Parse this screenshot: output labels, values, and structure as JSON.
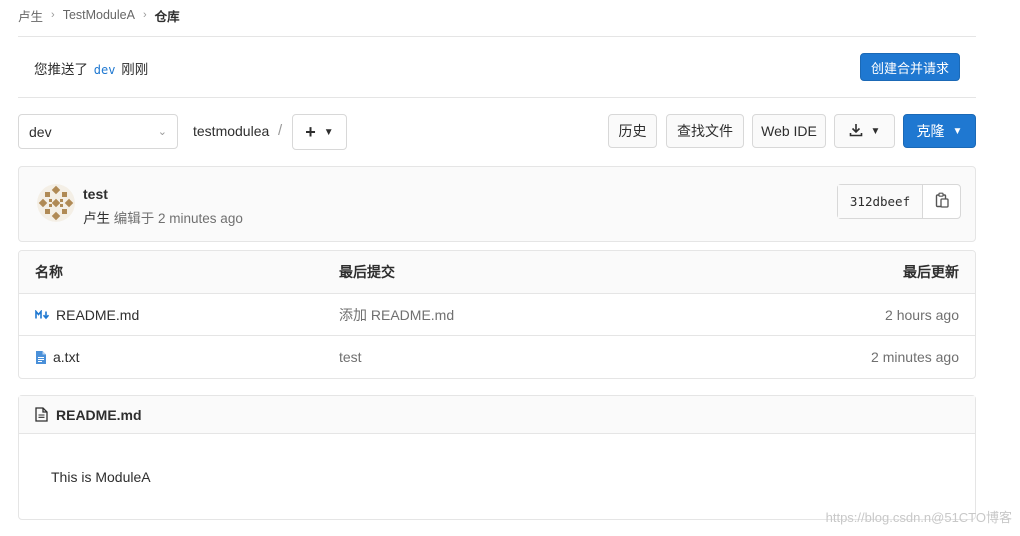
{
  "breadcrumb": {
    "items": [
      "卢生",
      "TestModuleA"
    ],
    "current": "仓库"
  },
  "push_banner": {
    "prefix": "您推送了",
    "branch": "dev",
    "suffix": "刚刚",
    "button_label": "创建合并请求"
  },
  "toolbar": {
    "branch": "dev",
    "path": "testmodulea",
    "path_separator": "/",
    "history_label": "历史",
    "find_file_label": "查找文件",
    "web_ide_label": "Web IDE",
    "clone_label": "克隆"
  },
  "last_commit": {
    "title": "test",
    "author": "卢生",
    "action": "编辑于",
    "time": "2 minutes ago",
    "sha": "312dbeef"
  },
  "file_table": {
    "headers": {
      "name": "名称",
      "last_commit": "最后提交",
      "last_update": "最后更新"
    },
    "rows": [
      {
        "name": "README.md",
        "icon": "markdown-icon",
        "commit": "添加 README.md",
        "updated": "2 hours ago"
      },
      {
        "name": "a.txt",
        "icon": "text-file-icon",
        "commit": "test",
        "updated": "2 minutes ago"
      }
    ]
  },
  "readme": {
    "filename": "README.md",
    "content": "This is ModuleA"
  },
  "watermark": "https://blog.csdn.n@51CTO博客",
  "colors": {
    "primary": "#1f78d1",
    "border": "#e5e5e5",
    "header_bg": "#fafafa",
    "muted_text": "#707070"
  }
}
